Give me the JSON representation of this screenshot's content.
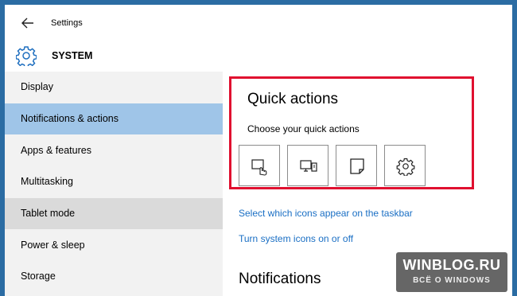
{
  "window": {
    "title": "Settings"
  },
  "header": {
    "title": "SYSTEM",
    "icon": "gear-icon"
  },
  "sidebar": {
    "items": [
      {
        "label": "Display",
        "state": "normal"
      },
      {
        "label": "Notifications & actions",
        "state": "selected"
      },
      {
        "label": "Apps & features",
        "state": "normal"
      },
      {
        "label": "Multitasking",
        "state": "normal"
      },
      {
        "label": "Tablet mode",
        "state": "hover"
      },
      {
        "label": "Power & sleep",
        "state": "normal"
      },
      {
        "label": "Storage",
        "state": "normal"
      }
    ]
  },
  "main": {
    "quick_actions": {
      "title": "Quick actions",
      "subtitle": "Choose your quick actions",
      "buttons": [
        "tablet-mode-icon",
        "project-icon",
        "note-icon",
        "settings-icon"
      ]
    },
    "links": {
      "taskbar_icons": "Select which icons appear on the taskbar",
      "system_icons": "Turn system icons on or off"
    },
    "notifications": {
      "title": "Notifications"
    }
  },
  "watermark": {
    "main": "WINBLOG.RU",
    "sub": "ВСЁ О WINDOWS"
  },
  "colors": {
    "selected": "#9fc5e8",
    "hover": "#dadada",
    "sidebar_bg": "#f2f2f2",
    "highlight_border": "#e0102f",
    "link": "#1a6fc4",
    "desktop": "#2b6ca3"
  }
}
